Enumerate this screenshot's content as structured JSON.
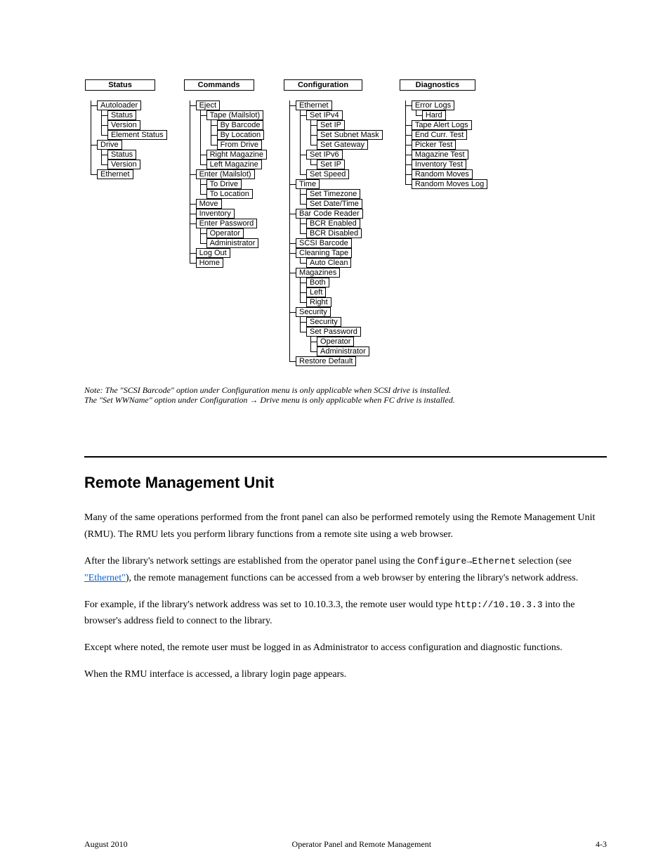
{
  "trees": {
    "status": {
      "header": "Status",
      "items": [
        "Autoloader",
        [
          "Status",
          "Version",
          "Element Status"
        ],
        "Drive",
        [
          "Status",
          "Version"
        ],
        "Ethernet"
      ]
    },
    "commands": {
      "header": "Commands",
      "items": [
        "Eject",
        [
          "Tape (Mailslot)",
          [
            "By Barcode",
            "By Location",
            "From Drive"
          ],
          "Right Magazine",
          "Left Magazine"
        ],
        "Enter (Mailslot)",
        [
          "To Drive",
          "To Location"
        ],
        "Move",
        "Inventory",
        "Enter Password",
        [
          "Operator",
          "Administrator"
        ],
        "Log Out",
        "Home"
      ]
    },
    "configuration": {
      "header": "Configuration",
      "items": [
        "Ethernet",
        [
          "Set IPv4",
          [
            "Set IP",
            "Set Subnet Mask",
            "Set Gateway"
          ],
          "Set IPv6",
          [
            "Set IP"
          ],
          "Set Speed"
        ],
        "Time",
        [
          "Set Timezone",
          "Set Date/Time"
        ],
        "Bar Code Reader",
        [
          "BCR Enabled",
          "BCR Disabled"
        ],
        "SCSI Barcode",
        "Cleaning Tape",
        [
          "Auto Clean"
        ],
        "Magazines",
        [
          "Both",
          "Left",
          "Right"
        ],
        "Security",
        [
          "Security",
          "Set Password",
          [
            "Operator",
            "Administrator"
          ]
        ],
        "Restore Default"
      ]
    },
    "diagnostics": {
      "header": "Diagnostics",
      "items": [
        "Error Logs",
        [
          "Hard"
        ],
        "Tape Alert Logs",
        "End Curr. Test",
        "Picker Test",
        "Magazine Test",
        "Inventory Test",
        "Random Moves",
        "Random Moves Log"
      ]
    }
  },
  "fig_caption_line_a": "Note: The \"SCSI Barcode\" option under Configuration menu is only applicable when SCSI drive is installed.",
  "fig_caption_line_b": "The \"Set WWName\" option under Configuration → Drive menu is only applicable when FC drive is installed.",
  "section_title": "Remote Management Unit",
  "p1": "Many of the same operations performed from the front panel can also be performed remotely using the Remote Management Unit (RMU). The RMU lets you perform library functions from a remote site using a web browser.",
  "p2_a": "After the library's network settings are established from the operator panel using the ",
  "p2_b": " selection (see ",
  "p2_c": "), the remote management functions can be accessed from a web browser by entering the library's network address.",
  "p2_cfg_eth": "Configure→Ethernet",
  "p2_link_text": "\"Ethernet\"",
  "p3_a": "For example, if the library's network address was set to 10.10.3.3, the remote user would type ",
  "p3_url": "http://10.10.3.3",
  "p3_b": " into the browser's address field to connect to the library.",
  "p4": "Except where noted, the remote user must be logged in as Administrator to access configuration and diagnostic functions.",
  "p5": "When the RMU interface is accessed, a library login page appears.",
  "footer_left": "August 2010",
  "footer_center": "Operator Panel and Remote Management",
  "footer_right": "4-3"
}
